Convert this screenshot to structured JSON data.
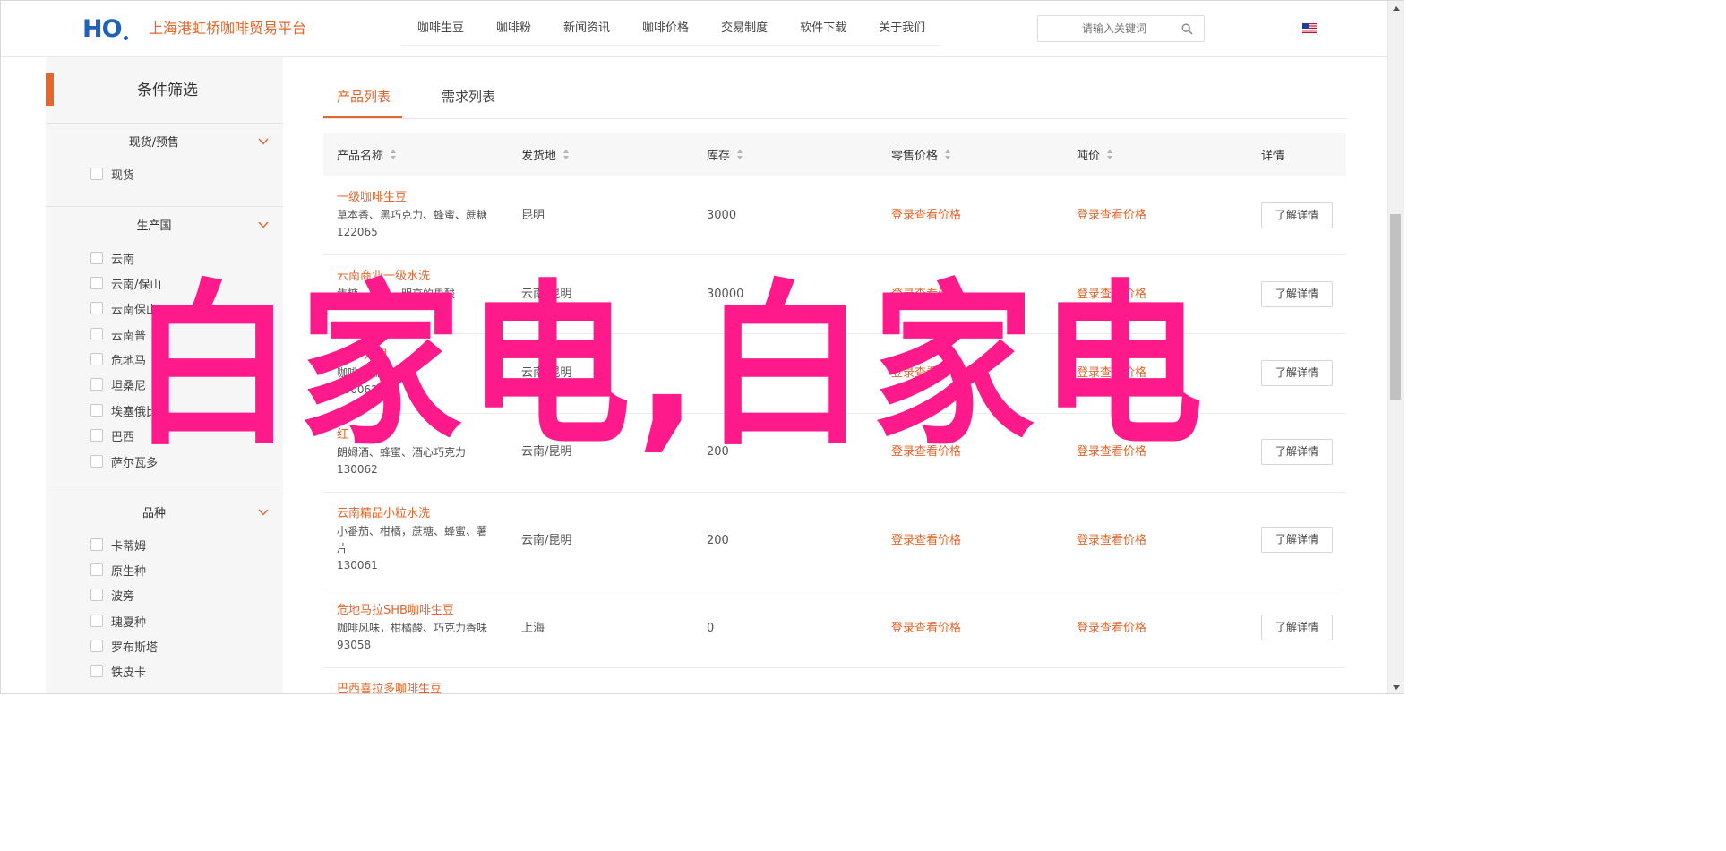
{
  "header": {
    "logo_text": "H",
    "logo_o": "O",
    "brand_name": "上海港虹桥咖啡贸易平台",
    "nav": [
      "咖啡生豆",
      "咖啡粉",
      "新闻资讯",
      "咖啡价格",
      "交易制度",
      "软件下载",
      "关于我们"
    ],
    "search_placeholder": "请输入关键词",
    "search_icon": "search-icon",
    "language_icon": "us-flag-icon"
  },
  "sidebar": {
    "title": "条件筛选",
    "groups": [
      {
        "title": "现货/预售",
        "options": [
          "现货"
        ]
      },
      {
        "title": "生产国",
        "options": [
          "云南",
          "云南/保山",
          "云南保山",
          "云南普",
          "危地马",
          "坦桑尼",
          "埃塞俄比亚",
          "巴西",
          "萨尔瓦多"
        ]
      },
      {
        "title": "品种",
        "options": [
          "卡蒂姆",
          "原生种",
          "波旁",
          "瑰夏种",
          "罗布斯塔",
          "铁皮卡"
        ]
      }
    ]
  },
  "tabs": {
    "products": "产品列表",
    "demand": "需求列表"
  },
  "table": {
    "headers": [
      "产品名称",
      "发货地",
      "库存",
      "零售价格",
      "吨价",
      "详情"
    ],
    "rows": [
      {
        "name": "一级咖啡生豆",
        "desc": "草本香、黑巧克力、蜂蜜、蔗糖",
        "id": "122065",
        "origin": "昆明",
        "stock": "3000",
        "retail": "登录查看价格",
        "ton": "登录查看价格",
        "action": "了解详情"
      },
      {
        "name": "云南商业一级水洗",
        "desc": "焦糖、榛子，明亮的果酸",
        "id": "",
        "origin": "云南/昆明",
        "stock": "30000",
        "retail": "登录查看价格",
        "ton": "登录查看价格",
        "action": "了解详情"
      },
      {
        "name": "处理",
        "desc": "咖啡 黑糖",
        "id": "130062",
        "origin": "云南/昆明",
        "stock": "",
        "retail": "登录查看价格",
        "ton": "登录查看价格",
        "action": "了解详情"
      },
      {
        "name": "红",
        "desc": "朗姆酒、蜂蜜、酒心巧克力",
        "id": "130062",
        "origin": "云南/昆明",
        "stock": "200",
        "retail": "登录查看价格",
        "ton": "登录查看价格",
        "action": "了解详情"
      },
      {
        "name": "云南精品小粒水洗",
        "desc": "小番茄、柑橘，蔗糖、蜂蜜、薯片",
        "id": "130061",
        "origin": "云南/昆明",
        "stock": "200",
        "retail": "登录查看价格",
        "ton": "登录查看价格",
        "action": "了解详情"
      },
      {
        "name": "危地马拉SHB咖啡生豆",
        "desc": "咖啡风味，柑橘酸、巧克力香味",
        "id": "93058",
        "origin": "上海",
        "stock": "0",
        "retail": "登录查看价格",
        "ton": "登录查看价格",
        "action": "了解详情"
      },
      {
        "name": "巴西喜拉多咖啡生豆",
        "desc": "",
        "id": "",
        "origin": "",
        "stock": "",
        "retail": "",
        "ton": "",
        "action": ""
      }
    ]
  },
  "watermark": "白家电,白家电",
  "colors": {
    "accent": "#e5652b",
    "brand_blue": "#1e63b8",
    "watermark": "#ff1a8c"
  }
}
